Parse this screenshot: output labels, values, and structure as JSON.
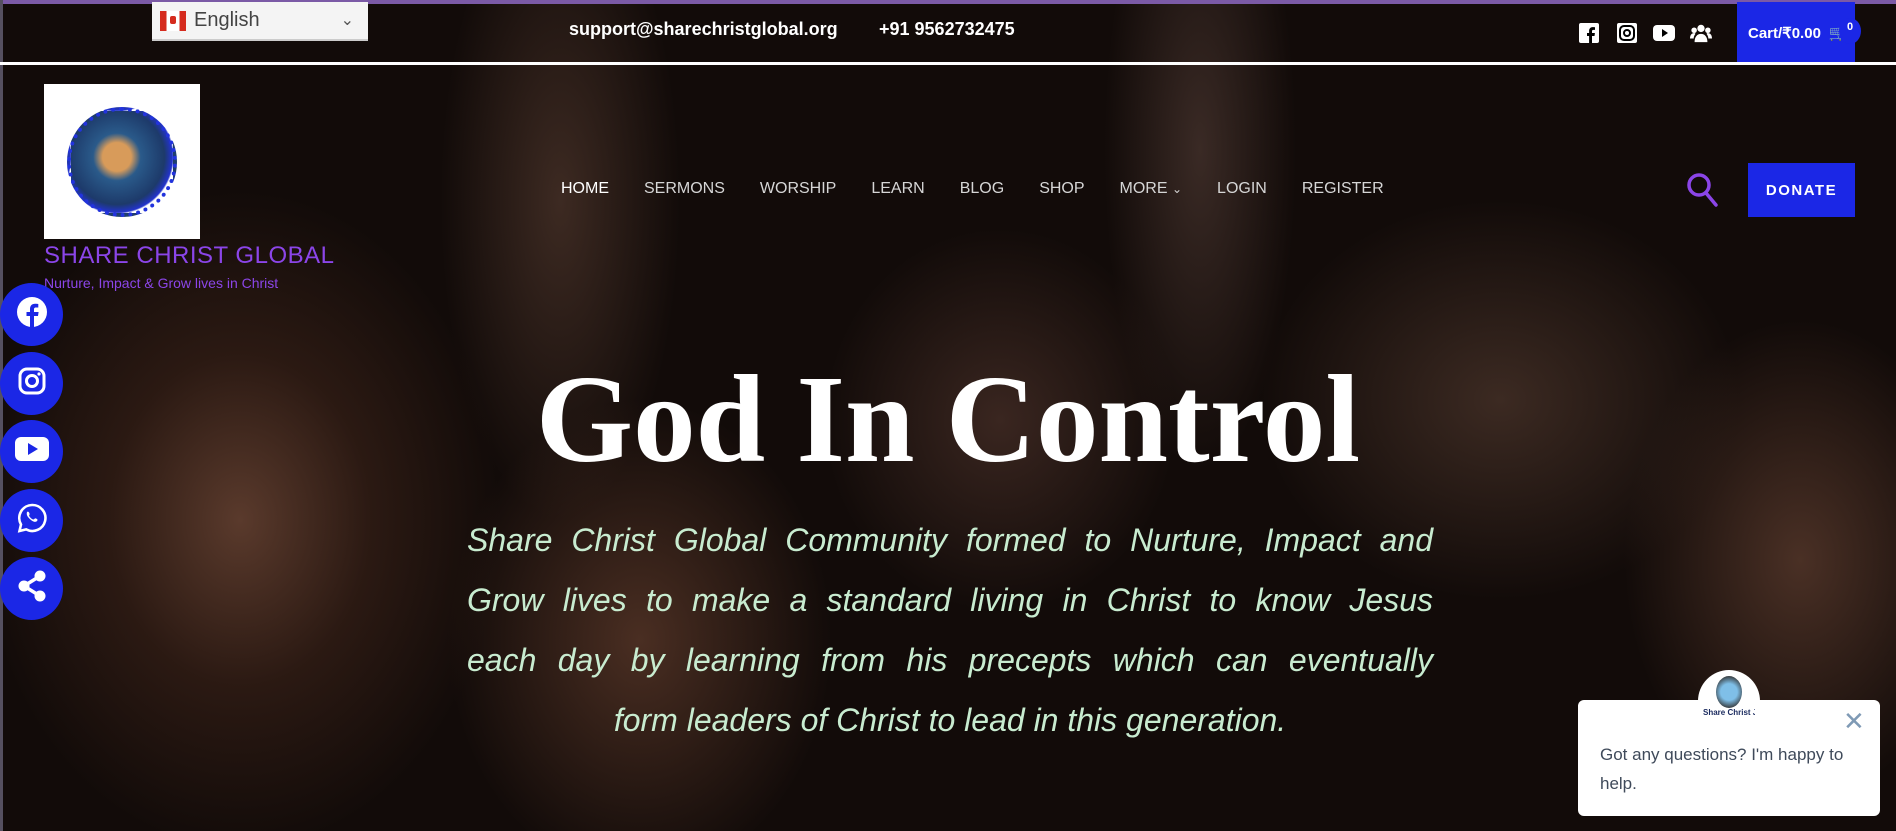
{
  "topbar": {
    "language": "English",
    "email": "support@sharechristglobal.org",
    "phone": "+91 9562732475",
    "social_icons": [
      "facebook-square-icon",
      "instagram-icon",
      "youtube-icon",
      "users-icon"
    ],
    "cart_label": "Cart/₹0.00",
    "cart_count": "0"
  },
  "brand": {
    "logo_text": "SHARE CHRIST GLOBAL",
    "name": "SHARE CHRIST GLOBAL",
    "tagline": "Nurture, Impact & Grow lives in Christ"
  },
  "nav": {
    "items": [
      "HOME",
      "SERMONS",
      "WORSHIP",
      "LEARN",
      "BLOG",
      "SHOP",
      "MORE",
      "LOGIN",
      "REGISTER"
    ],
    "active": "HOME",
    "donate": "DONATE"
  },
  "floating_social": [
    "facebook-icon",
    "instagram-icon",
    "youtube-icon",
    "whatsapp-icon",
    "share-icon"
  ],
  "hero": {
    "title": "God In Control",
    "paragraph_lines": [
      "Share Christ Global Community formed to Nurture, Impact and",
      "Grow lives to make a standard living in Christ to know Jesus",
      "each day by learning from his precepts which can eventually",
      "form leaders of Christ to lead in this generation."
    ]
  },
  "chat": {
    "avatar_text": "Share Christ Jesus",
    "message": "Got any questions? I'm happy to help."
  },
  "colors": {
    "accent": "#1b27e6",
    "brand_purple": "#8b45e8",
    "hero_text": "#c8ecd0"
  }
}
